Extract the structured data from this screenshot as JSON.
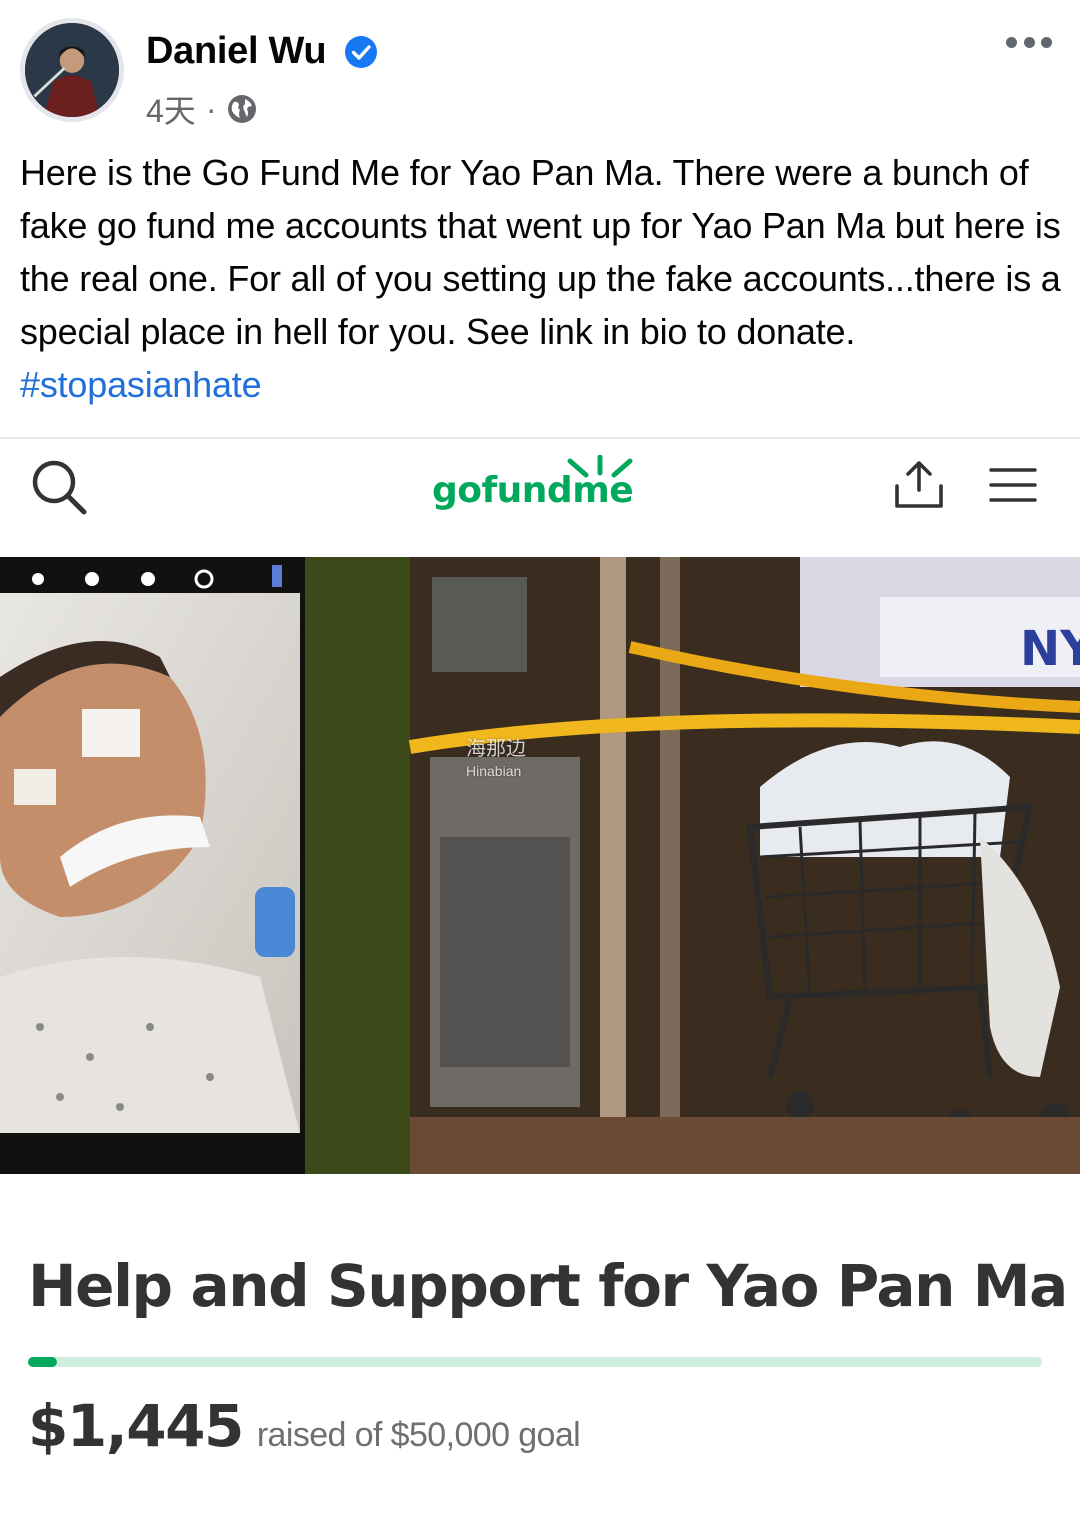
{
  "post": {
    "author": "Daniel Wu",
    "time": "4天",
    "separator": "·",
    "text": "Here is the Go Fund Me for Yao Pan Ma. There were a bunch of fake go fund me accounts that went up for Yao Pan Ma but here is the real one. For all of you setting up the fake accounts...there is a special place in hell for you. See link in bio to donate. ",
    "hashtag": "#stopasianhate",
    "icons": [
      "verified-icon",
      "globe-icon",
      "more-options-icon"
    ]
  },
  "gofundme": {
    "logo_text": "gofundme",
    "icons": [
      "search-icon",
      "share-icon",
      "menu-icon"
    ],
    "watermark": "海那边",
    "watermark_latin": "Hinabian",
    "title": "Help and Support for Yao Pan Ma",
    "raised": "$1,445",
    "raised_caption": "raised of $50,000 goal",
    "progress_fraction": 0.029,
    "colors": {
      "brand": "#02a95c",
      "track": "#cfeee0",
      "hashtag": "#216fdb",
      "verified": "#1877f2"
    }
  }
}
